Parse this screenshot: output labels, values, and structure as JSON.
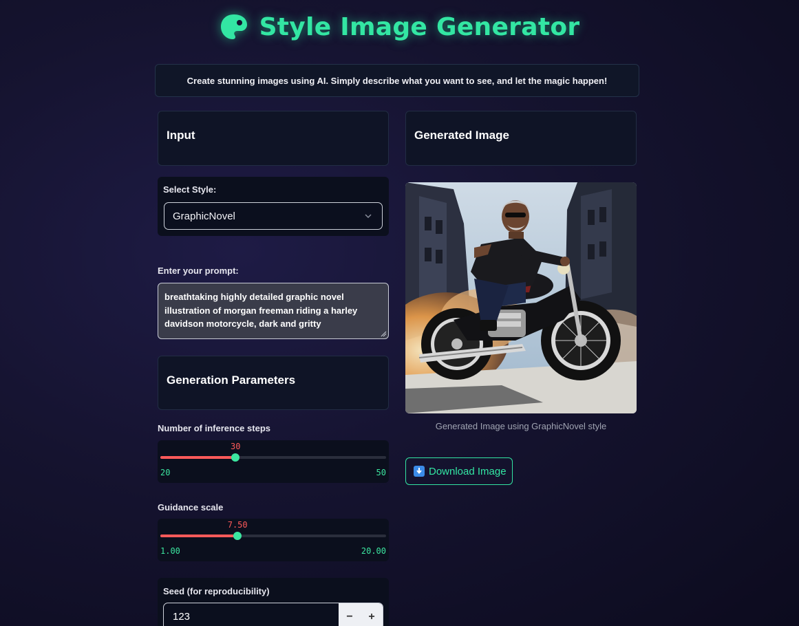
{
  "header": {
    "title": "Style Image Generator",
    "icon": "palette-icon"
  },
  "subtitle": "Create stunning images using AI. Simply describe what you want to see, and let the magic happen!",
  "input_section": {
    "title": "Input"
  },
  "style_select": {
    "label": "Select Style:",
    "value": "GraphicNovel"
  },
  "prompt": {
    "label": "Enter your prompt:",
    "value": "breathtaking highly detailed graphic novel illustration of morgan freeman riding a harley davidson motorcycle, dark and gritty"
  },
  "params_section": {
    "title": "Generation Parameters"
  },
  "steps_slider": {
    "label": "Number of inference steps",
    "value": "30",
    "min": "20",
    "max": "50",
    "fraction": 0.333
  },
  "guidance_slider": {
    "label": "Guidance scale",
    "value": "7.50",
    "min": "1.00",
    "max": "20.00",
    "fraction": 0.342
  },
  "seed": {
    "label": "Seed (for reproducibility)",
    "value": "123",
    "minus": "−",
    "plus": "+"
  },
  "output_section": {
    "title": "Generated Image"
  },
  "image": {
    "caption": "Generated Image using GraphicNovel style"
  },
  "download": {
    "label": "Download Image",
    "icon": "download-arrow-icon"
  },
  "colors": {
    "accent": "#33e6a3",
    "slider_fill": "#ff5a5a",
    "background": "#15132f"
  }
}
